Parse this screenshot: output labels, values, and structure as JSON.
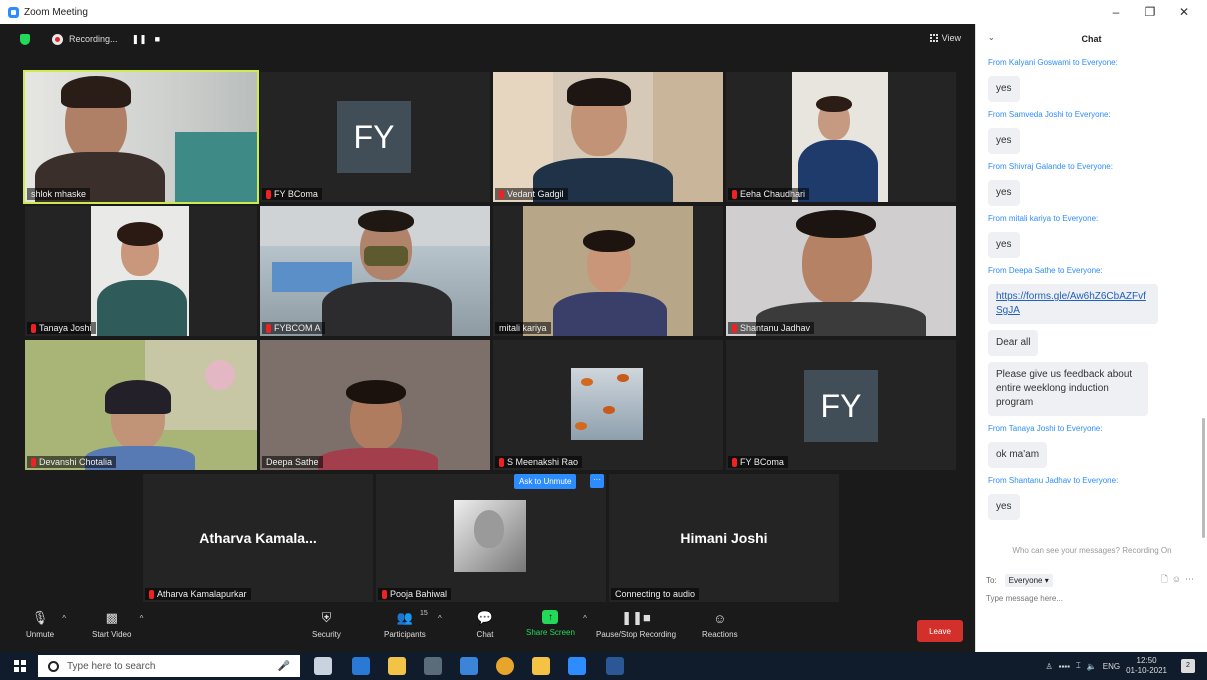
{
  "window": {
    "title": "Zoom Meeting",
    "controls": [
      "–",
      "❐",
      "✕"
    ]
  },
  "topbar": {
    "recording_label": "Recording...",
    "pause_label": "❚❚",
    "stop_label": "■",
    "view_label": "View"
  },
  "participants": [
    {
      "name": "shlok mhaske",
      "muted": false,
      "type": "video"
    },
    {
      "name": "FY BComa",
      "muted": true,
      "type": "avatar",
      "initials": "FY"
    },
    {
      "name": "Vedant Gadgil",
      "muted": true,
      "type": "video"
    },
    {
      "name": "Eeha Chaudhari",
      "muted": true,
      "type": "video"
    },
    {
      "name": "Tanaya Joshi",
      "muted": true,
      "type": "video"
    },
    {
      "name": "FYBCOM A",
      "muted": true,
      "type": "video"
    },
    {
      "name": "mitali kariya",
      "muted": false,
      "type": "video"
    },
    {
      "name": "Shantanu Jadhav",
      "muted": true,
      "type": "video"
    },
    {
      "name": "Devanshi Chotalia",
      "muted": true,
      "type": "video"
    },
    {
      "name": "Deepa Sathe",
      "muted": false,
      "type": "video"
    },
    {
      "name": "S Meenakshi Rao",
      "muted": true,
      "type": "image"
    },
    {
      "name": "FY BComa",
      "muted": true,
      "type": "avatar",
      "initials": "FY"
    },
    {
      "name": "Atharva Kamalapurkar",
      "display": "Atharva  Kamala...",
      "muted": true,
      "type": "name"
    },
    {
      "name": "Pooja Bahiwal",
      "muted": true,
      "type": "image"
    },
    {
      "name": "Connecting to audio",
      "display": "Himani Joshi",
      "muted": false,
      "type": "name"
    }
  ],
  "ask_unmute_label": "Ask to Unmute",
  "ask_more_label": "···",
  "controls": {
    "unmute": "Unmute",
    "start_video": "Start Video",
    "security": "Security",
    "participants": "Participants",
    "participants_count": "15",
    "chat": "Chat",
    "share_screen": "Share Screen",
    "pause_stop_recording": "Pause/Stop Recording",
    "reactions": "Reactions",
    "leave": "Leave"
  },
  "chat": {
    "title": "Chat",
    "messages": [
      {
        "from": "From Kalyani Goswami to Everyone:",
        "text": "yes"
      },
      {
        "from": "From Samveda Joshi to Everyone:",
        "text": "yes"
      },
      {
        "from": "From Shivraj Galande to Everyone:",
        "text": "yes"
      },
      {
        "from": "From mitali kariya to Everyone:",
        "text": "yes"
      },
      {
        "from": "From Deepa Sathe to Everyone:",
        "link": "https://forms.gle/Aw6hZ6CbAZFvfSgJA"
      },
      {
        "from": "",
        "text": "Dear all"
      },
      {
        "from": "",
        "text": "Please give us feedback about entire weeklong induction program"
      },
      {
        "from": "From Tanaya Joshi to Everyone:",
        "text": "ok ma'am"
      },
      {
        "from": "From Shantanu Jadhav to Everyone:",
        "text": "yes"
      }
    ],
    "who_can_see": "Who can see your messages? Recording On",
    "to_label": "To:",
    "to_value": "Everyone ▾",
    "input_placeholder": "Type message here..."
  },
  "taskbar": {
    "search_placeholder": "Type here to search",
    "lang": "ENG",
    "time": "12:50",
    "date": "01-10-2021",
    "notif_count": "2"
  }
}
